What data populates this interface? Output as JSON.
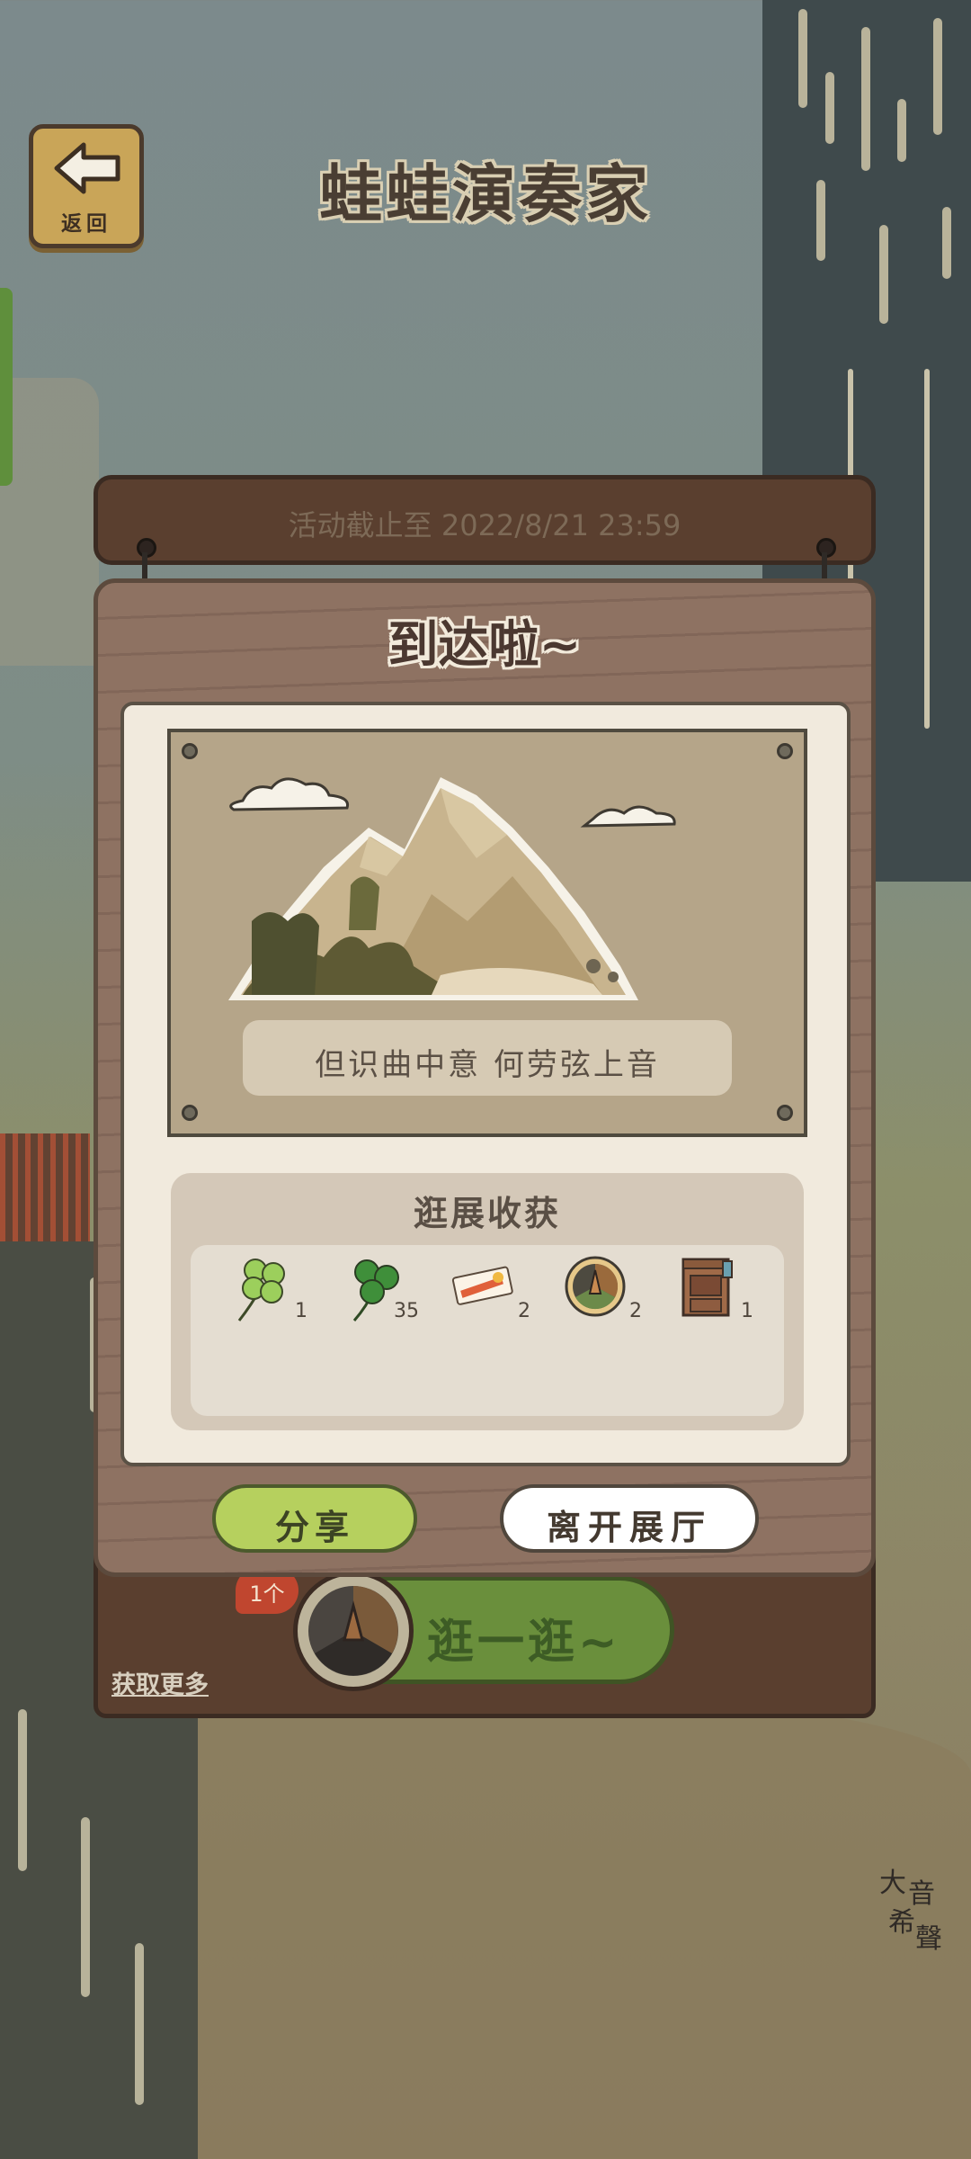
{
  "header": {
    "back_label": "返回",
    "title": "蛙蛙演奏家"
  },
  "event": {
    "deadline": "活动截止至 2022/8/21 23:59"
  },
  "popup": {
    "title": "到达啦~",
    "caption": "但识曲中意 何劳弦上音",
    "rewards_title": "逛展收获",
    "rewards": [
      {
        "name": "four-leaf-clover-icon",
        "count": "1"
      },
      {
        "name": "three-leaf-clover-icon",
        "count": "35"
      },
      {
        "name": "ticket-icon",
        "count": "2"
      },
      {
        "name": "exhibit-plate-icon",
        "count": "2"
      },
      {
        "name": "wooden-cabinet-icon",
        "count": "1"
      }
    ],
    "share_label": "分享",
    "leave_label": "离开展厅"
  },
  "bottom": {
    "get_more": "获取更多",
    "visit_label": "逛一逛~",
    "badge": "1个"
  },
  "watermark": {
    "chars": [
      "大",
      "音",
      "希",
      "聲"
    ]
  },
  "colors": {
    "board_wood": "#8e7262",
    "share_green": "#b6d05e",
    "visit_green": "#6a8f3c",
    "card_bg": "#f1eadd"
  }
}
